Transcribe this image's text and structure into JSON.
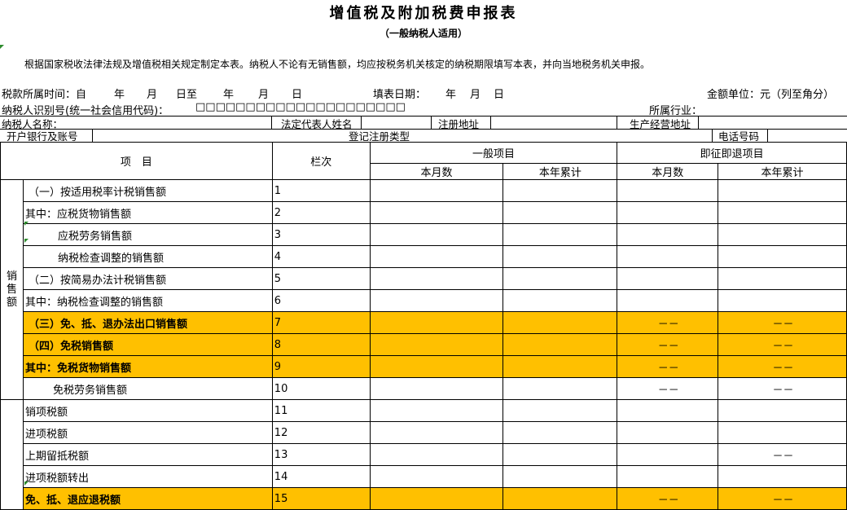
{
  "title": "增值税及附加税费申报表",
  "subtitle": "（一般纳税人适用）",
  "instruction": "根据国家税收法律法规及增值税相关规定制定本表。纳税人不论有无销售额，均应按税务机关核定的纳税期限填写本表，并向当地税务机关申报。",
  "info": {
    "period_label": "税款所属时间：自",
    "year1": "年",
    "month1": "月",
    "day_to": "日至",
    "year2": "年",
    "month2": "月",
    "day2": "日",
    "fill_date_label": "填表日期：",
    "fill_year": "年",
    "fill_month": "月",
    "fill_day": "日",
    "unit_label": "金额单位：元（列至角分）",
    "taxpayer_id_label": "纳税人识别号(统一社会信用代码)：",
    "taxpayer_id_boxes": "□□□□□□□□□□□□□□□□□□□□□",
    "industry_label": "所属行业：",
    "name_label": "纳税人名称：",
    "legal_rep_label": "法定代表人姓名",
    "reg_address_label": "注册地址",
    "biz_address_label": "生产经营地址",
    "bank_label": "开户银行及账号",
    "reg_type_label": "登记注册类型",
    "phone_label": "电话号码"
  },
  "table": {
    "col_item": "项　目",
    "col_line": "栏次",
    "group_general": "一般项目",
    "group_refund": "即征即退项目",
    "sub_month": "本月数",
    "sub_year": "本年累计",
    "section_sales": "销售额",
    "dash": "－－",
    "rows": [
      {
        "label": "（一）按适用税率计税销售额",
        "line": "1"
      },
      {
        "label": "其中：应税货物销售额",
        "line": "2"
      },
      {
        "label": "应税劳务销售额",
        "line": "3"
      },
      {
        "label": "纳税检查调整的销售额",
        "line": "4"
      },
      {
        "label": "（二）按简易办法计税销售额",
        "line": "5"
      },
      {
        "label": "其中：纳税检查调整的销售额",
        "line": "6"
      },
      {
        "label": "（三）免、抵、退办法出口销售额",
        "line": "7"
      },
      {
        "label": "（四）免税销售额",
        "line": "8"
      },
      {
        "label": "其中：免税货物销售额",
        "line": "9"
      },
      {
        "label": "免税劳务销售额",
        "line": "10"
      },
      {
        "label": "销项税额",
        "line": "11"
      },
      {
        "label": "进项税额",
        "line": "12"
      },
      {
        "label": "上期留抵税额",
        "line": "13"
      },
      {
        "label": "进项税额转出",
        "line": "14"
      },
      {
        "label": "免、抵、退应退税额",
        "line": "15"
      }
    ]
  },
  "colors": {
    "highlight": "#ffc000",
    "marker": "#2e8b2e"
  }
}
